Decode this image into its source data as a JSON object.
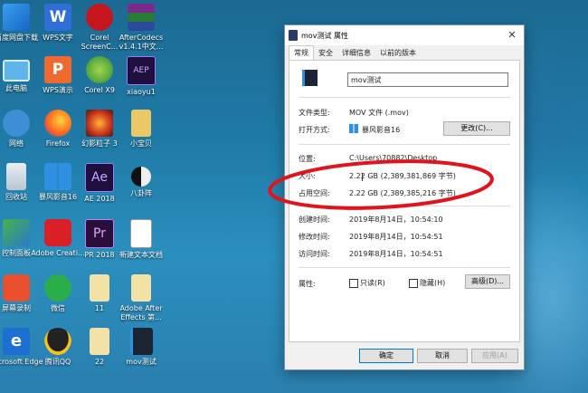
{
  "desktop": {
    "icons": [
      {
        "label": "百度网盘下载"
      },
      {
        "label": "WPS文字"
      },
      {
        "label": "Corel ScreenC..."
      },
      {
        "label": "AfterCodecs v1.4.1中文..."
      },
      {
        "label": "此电脑"
      },
      {
        "label": "WPS演示"
      },
      {
        "label": "Corel X9"
      },
      {
        "label": "xiaoyu1"
      },
      {
        "label": "网络"
      },
      {
        "label": "Firefox"
      },
      {
        "label": "幻影粒子 3"
      },
      {
        "label": "小宝贝"
      },
      {
        "label": "回收站"
      },
      {
        "label": "暴风影音16"
      },
      {
        "label": "AE 2018"
      },
      {
        "label": "八卦阵"
      },
      {
        "label": "控制面板"
      },
      {
        "label": "Adobe Creati..."
      },
      {
        "label": "PR 2018"
      },
      {
        "label": "新建文本文档"
      },
      {
        "label": "屏幕录制"
      },
      {
        "label": "微信"
      },
      {
        "label": "11"
      },
      {
        "label": "Adobe After Effects 第..."
      },
      {
        "label": "Microsoft Edge"
      },
      {
        "label": "腾讯QQ"
      },
      {
        "label": "22"
      },
      {
        "label": "mov测试"
      }
    ],
    "icon_glyphs": {
      "wps": "W",
      "wpsp": "P",
      "ae": "Ae",
      "aep": "AEP",
      "pr": "Pr",
      "ae2": "Ae",
      "edge": "e"
    }
  },
  "dialog": {
    "title": "mov测试 属性",
    "close": "✕",
    "tabs": [
      "常规",
      "安全",
      "详细信息",
      "以前的版本"
    ],
    "filename": "mov测试",
    "rows": {
      "type_label": "文件类型:",
      "type_value": "MOV 文件 (.mov)",
      "open_label": "打开方式:",
      "open_value": "暴风影音16",
      "change_btn": "更改(C)...",
      "location_label": "位置:",
      "location_value": "C:\\Users\\70882\\Desktop",
      "size_label": "大小:",
      "size_value": "2.22 GB (2,389,381,869 字节)",
      "disk_label": "占用空间:",
      "disk_value": "2.22 GB (2,389,385,216 字节)",
      "created_label": "创建时间:",
      "created_value": "2019年8月14日，10:54:10",
      "modified_label": "修改时间:",
      "modified_value": "2019年8月14日，10:54:51",
      "accessed_label": "访问时间:",
      "accessed_value": "2019年8月14日，10:54:51",
      "attr_label": "属性:",
      "readonly": "只读(R)",
      "hidden": "隐藏(H)",
      "advanced_btn": "高级(D)..."
    },
    "buttons": {
      "ok": "确定",
      "cancel": "取消",
      "apply": "应用(A)"
    }
  },
  "colors": {
    "highlight": "#e0141e",
    "accent": "#0078d7"
  }
}
